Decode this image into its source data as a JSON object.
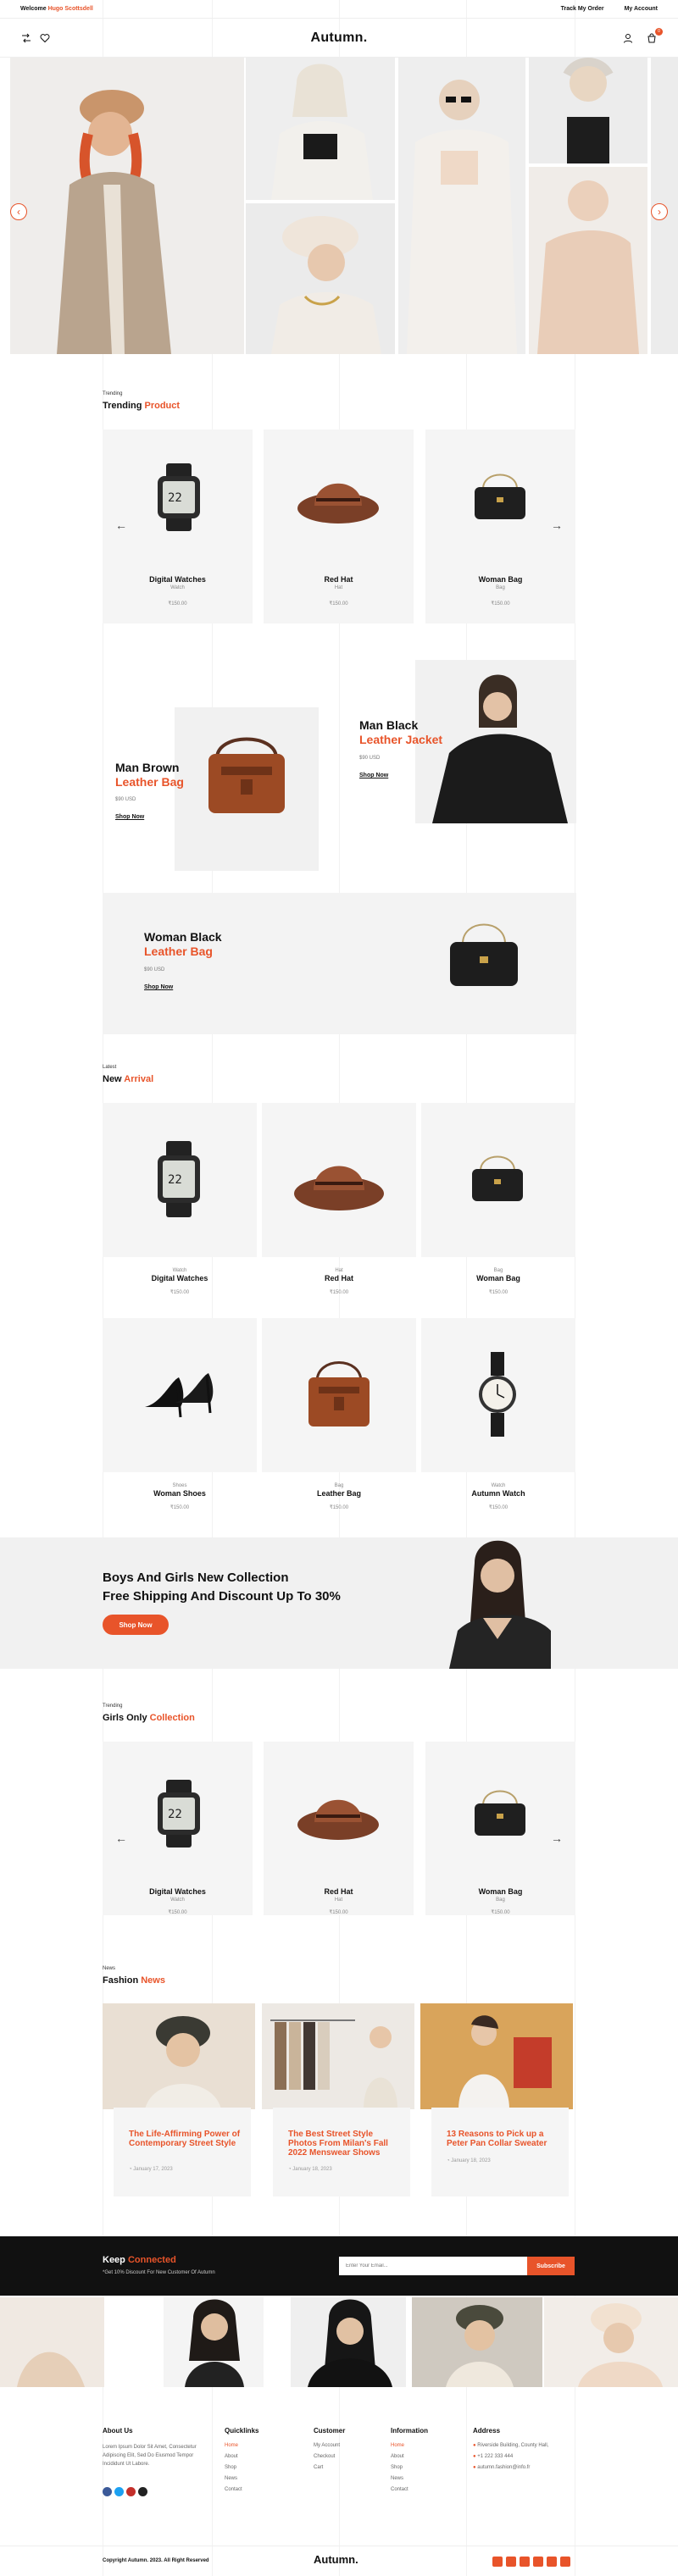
{
  "topbar": {
    "welcome_prefix": "Welcome",
    "welcome_user": "Hugo Scottsdell",
    "track_order": "Track My Order",
    "my_account": "My Account"
  },
  "header": {
    "logo": "Autumn.",
    "cart_count": "0"
  },
  "hero": {
    "prev": "‹",
    "next": "›"
  },
  "trending": {
    "eyebrow": "Trending",
    "title_a": "Trending ",
    "title_b": "Product",
    "items": [
      {
        "name": "Digital Watches",
        "category": "Watch",
        "price": "₹150.00"
      },
      {
        "name": "Red Hat",
        "category": "Hat",
        "price": "₹150.00"
      },
      {
        "name": "Woman Bag",
        "category": "Bag",
        "price": "₹150.00"
      }
    ]
  },
  "promos": {
    "jacket": {
      "line1": "Man Black",
      "line2": "Leather Jacket",
      "price": "$90 USD",
      "link": "Shop Now"
    },
    "bag": {
      "line1": "Man Brown",
      "line2": "Leather Bag",
      "price": "$90 USD",
      "link": "Shop Now"
    },
    "woman_bag": {
      "line1": "Woman Black",
      "line2": "Leather Bag",
      "price": "$90 USD",
      "link": "Shop Now"
    }
  },
  "arrival": {
    "eyebrow": "Latest",
    "title_a": "New ",
    "title_b": "Arrival",
    "items": [
      {
        "name": "Digital Watches",
        "category": "Watch",
        "price": "₹150.00"
      },
      {
        "name": "Red Hat",
        "category": "Hat",
        "price": "₹150.00"
      },
      {
        "name": "Woman Bag",
        "category": "Bag",
        "price": "₹150.00"
      },
      {
        "name": "Woman Shoes",
        "category": "Shoes",
        "price": "₹150.00"
      },
      {
        "name": "Leather Bag",
        "category": "Bag",
        "price": "₹150.00"
      },
      {
        "name": "Autumn Watch",
        "category": "Watch",
        "price": "₹150.00"
      }
    ]
  },
  "banner": {
    "line1": "Boys And Girls New Collection",
    "line2": "Free Shipping And Discount Up To 30%",
    "button": "Shop Now"
  },
  "girls": {
    "eyebrow": "Trending",
    "title_a": "Girls Only ",
    "title_b": "Collection",
    "items": [
      {
        "name": "Digital Watches",
        "category": "Watch",
        "price": "₹150.00"
      },
      {
        "name": "Red Hat",
        "category": "Hat",
        "price": "₹150.00"
      },
      {
        "name": "Woman Bag",
        "category": "Bag",
        "price": "₹150.00"
      }
    ]
  },
  "news": {
    "eyebrow": "News",
    "title_a": "Fashion ",
    "title_b": "News",
    "items": [
      {
        "title": "The Life-Affirming Power of Contemporary Street Style",
        "date": "January 17, 2023"
      },
      {
        "title": "The Best Street Style Photos From Milan's Fall 2022 Menswear Shows",
        "date": "January 18, 2023"
      },
      {
        "title": "13 Reasons to Pick up a Peter Pan Collar Sweater",
        "date": "January 18, 2023"
      }
    ]
  },
  "newsletter": {
    "title_a": "Keep ",
    "title_b": "Connected",
    "sub": "*Get 10% Discount For New Customer Of Autumn",
    "placeholder": "Enter Your Email...",
    "button": "Subscribe"
  },
  "footer": {
    "about_title": "About Us",
    "about_text": "Lorem Ipsum Dolor Sit Amet, Consectetur Adipiscing Elit, Sed Do Eiusmod Tempor Incididunt Ut Labore.",
    "quicklinks_title": "Quicklinks",
    "quicklinks": [
      "Home",
      "About",
      "Shop",
      "News",
      "Contact"
    ],
    "customer_title": "Customer",
    "customer": [
      "My Account",
      "Checkout",
      "Cart"
    ],
    "information_title": "Information",
    "information": [
      "Home",
      "About",
      "Shop",
      "News",
      "Contact"
    ],
    "address_title": "Address",
    "address": [
      "Riverside Building, County Hall,",
      "+1 222 333 444",
      "autumn.fashion@info.fr"
    ],
    "copyright": "Copyright Autumn. 2023. All Right Reserved",
    "logo": "Autumn."
  },
  "colors": {
    "accent": "#e8542a",
    "dark": "#111111",
    "card": "#f5f5f5"
  }
}
